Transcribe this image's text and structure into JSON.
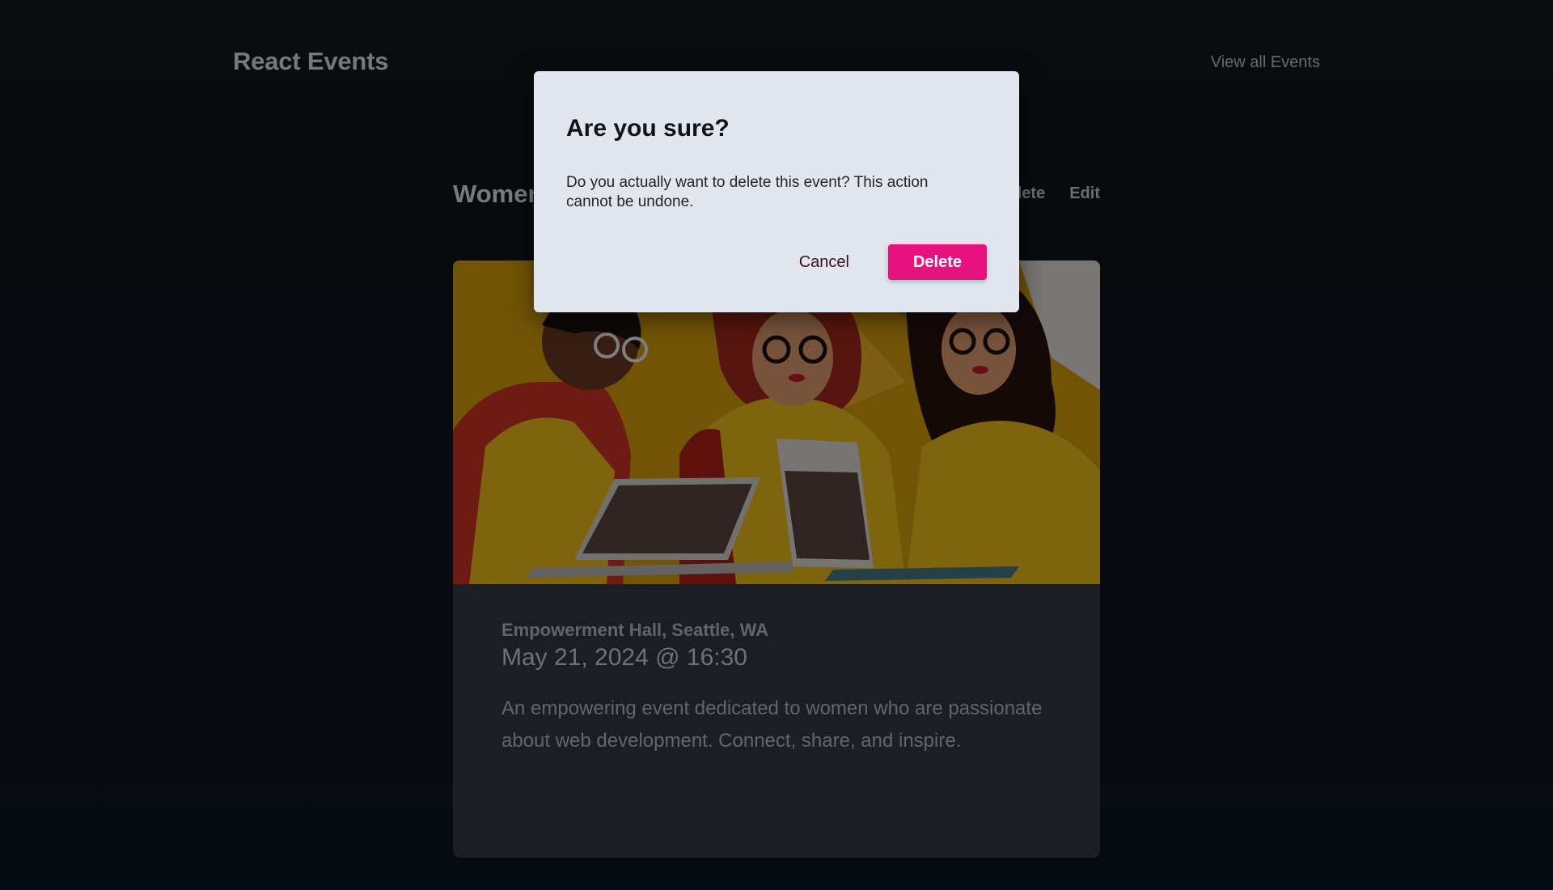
{
  "header": {
    "brand": "React Events",
    "nav_link": "View all Events"
  },
  "event": {
    "title": "Women in Web Development",
    "actions": {
      "delete_label": "Delete",
      "edit_label": "Edit"
    },
    "image_alt": "illustration-women-at-laptops",
    "location": "Empowerment Hall, Seattle, WA",
    "datetime": "May 21, 2024 @ 16:30",
    "description": "An empowering event dedicated to women who are passionate about web development. Connect, share, and inspire."
  },
  "modal": {
    "title": "Are you sure?",
    "text": "Do you actually want to delete this event? This action cannot be undone.",
    "cancel_label": "Cancel",
    "delete_label": "Delete"
  },
  "colors": {
    "accent": "#e6127d",
    "modal_bg": "#e2e6ee",
    "page_bg": "#121619",
    "card_bg": "#343a42"
  }
}
